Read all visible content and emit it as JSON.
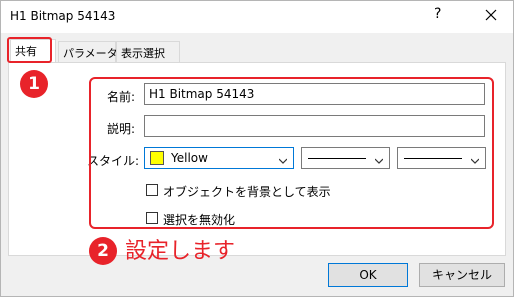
{
  "window": {
    "title": "H1 Bitmap 54143",
    "help_glyph": "?",
    "close_icon": "close-icon"
  },
  "tabs": [
    {
      "label": "共有",
      "active": true
    },
    {
      "label": "パラメータ",
      "active": false
    },
    {
      "label": "表示選択",
      "active": false
    }
  ],
  "form": {
    "name_label": "名前:",
    "name_value": "H1 Bitmap 54143",
    "description_label": "説明:",
    "description_value": "",
    "style_label": "スタイル:",
    "color_select": {
      "value": "Yellow",
      "swatch_color": "#ffff00"
    },
    "line_style_select": {
      "value": "solid-line"
    },
    "line_width_select": {
      "value": "thin-line"
    },
    "checkbox_background": {
      "label": "オブジェクトを背景として表示",
      "checked": false
    },
    "checkbox_disable_selection": {
      "label": "選択を無効化",
      "checked": false
    }
  },
  "annotations": {
    "badge_1": "1",
    "badge_2": "2",
    "note_2": "設定します",
    "highlight_color": "#e8232a"
  },
  "buttons": {
    "ok_label": "OK",
    "cancel_label": "キャンセル"
  }
}
